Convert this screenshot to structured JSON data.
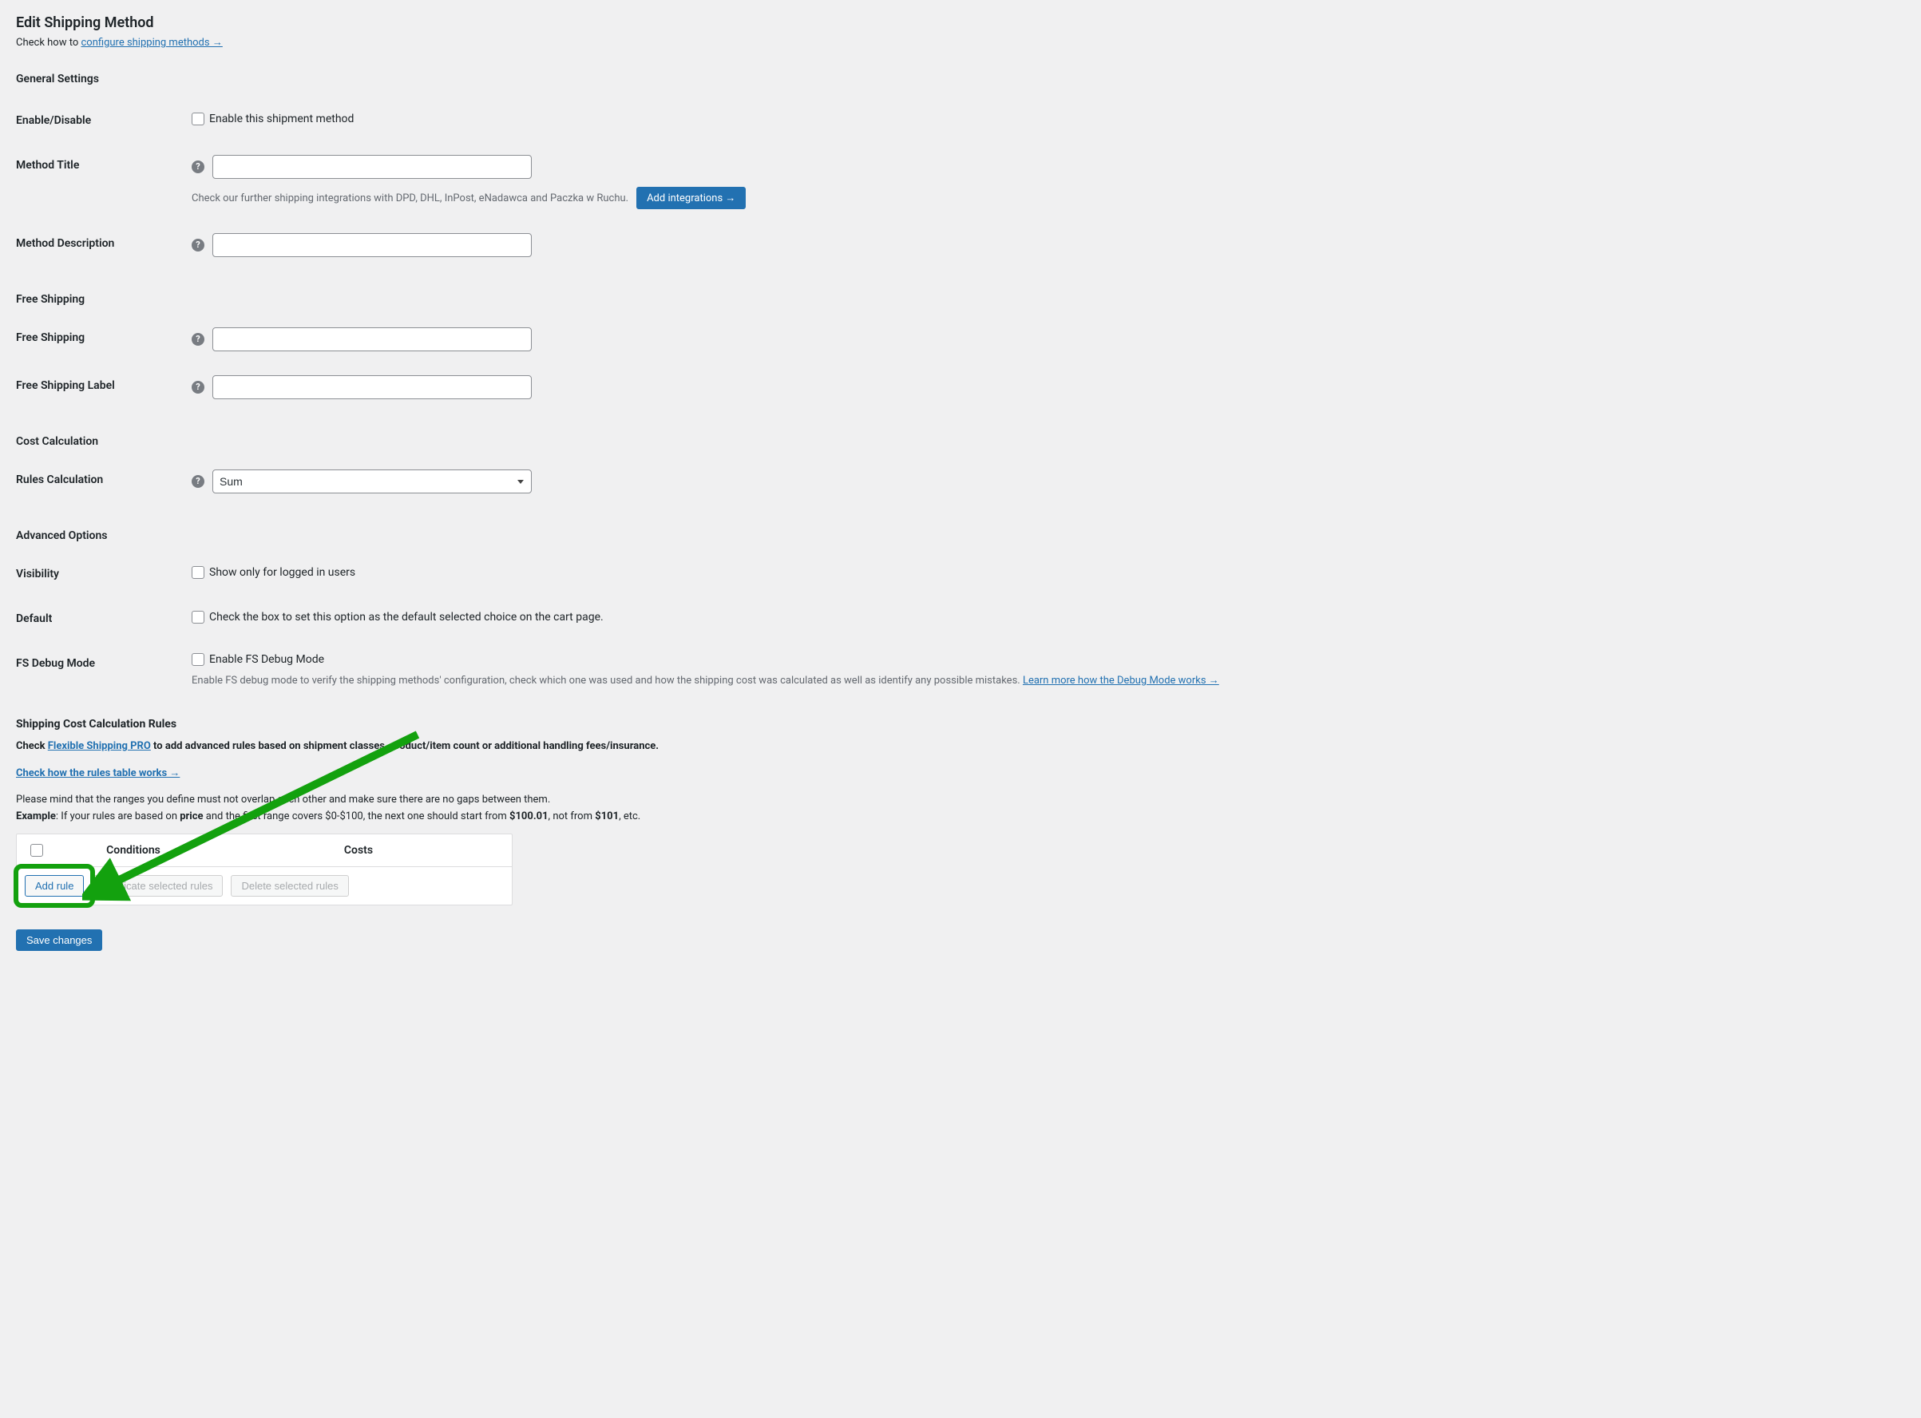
{
  "page": {
    "title": "Edit Shipping Method",
    "intro_prefix": "Check how to ",
    "intro_link": "configure shipping methods →"
  },
  "sections": {
    "general": "General Settings",
    "free": "Free Shipping",
    "cost": "Cost Calculation",
    "adv": "Advanced Options"
  },
  "labels": {
    "enable": "Enable/Disable",
    "enable_cb": "Enable this shipment method",
    "method_title": "Method Title",
    "method_title_note": "Check our further shipping integrations with DPD, DHL, InPost, eNadawca and Paczka w Ruchu.",
    "add_integrations": "Add integrations →",
    "method_desc": "Method Description",
    "free_shipping": "Free Shipping",
    "free_shipping_label": "Free Shipping Label",
    "rules_calc": "Rules Calculation",
    "rules_calc_value": "Sum",
    "visibility": "Visibility",
    "visibility_cb": "Show only for logged in users",
    "default": "Default",
    "default_cb": "Check the box to set this option as the default selected choice on the cart page.",
    "debug": "FS Debug Mode",
    "debug_cb": "Enable FS Debug Mode",
    "debug_desc_pre": "Enable FS debug mode to verify the shipping methods' configuration, check which one was used and how the shipping cost was calculated as well as identify any possible mistakes. ",
    "debug_link": "Learn more how the Debug Mode works →"
  },
  "rules": {
    "title": "Shipping Cost Calculation Rules",
    "check_pre": "Check ",
    "check_link": "Flexible Shipping PRO",
    "check_post": " to add advanced rules based on shipment classes, product/item count or additional handling fees/insurance.",
    "how_link": "Check how the rules table works →",
    "range_note": "Please mind that the ranges you define must not overlap each other and make sure there are no gaps between them.",
    "example_label": "Example",
    "example_body": ": If your rules are based on ",
    "example_price": "price",
    "example_body2": " and the first range covers $0-$100, the next one should start from ",
    "example_val1": "$100.01",
    "example_body3": ", not from ",
    "example_val2": "$101",
    "example_body4": ", etc.",
    "col_conditions": "Conditions",
    "col_costs": "Costs",
    "add_rule": "Add rule",
    "dup": "Duplicate selected rules",
    "del": "Delete selected rules"
  },
  "buttons": {
    "save": "Save changes"
  },
  "colors": {
    "primary": "#2271b1",
    "green": "#13a10e"
  }
}
